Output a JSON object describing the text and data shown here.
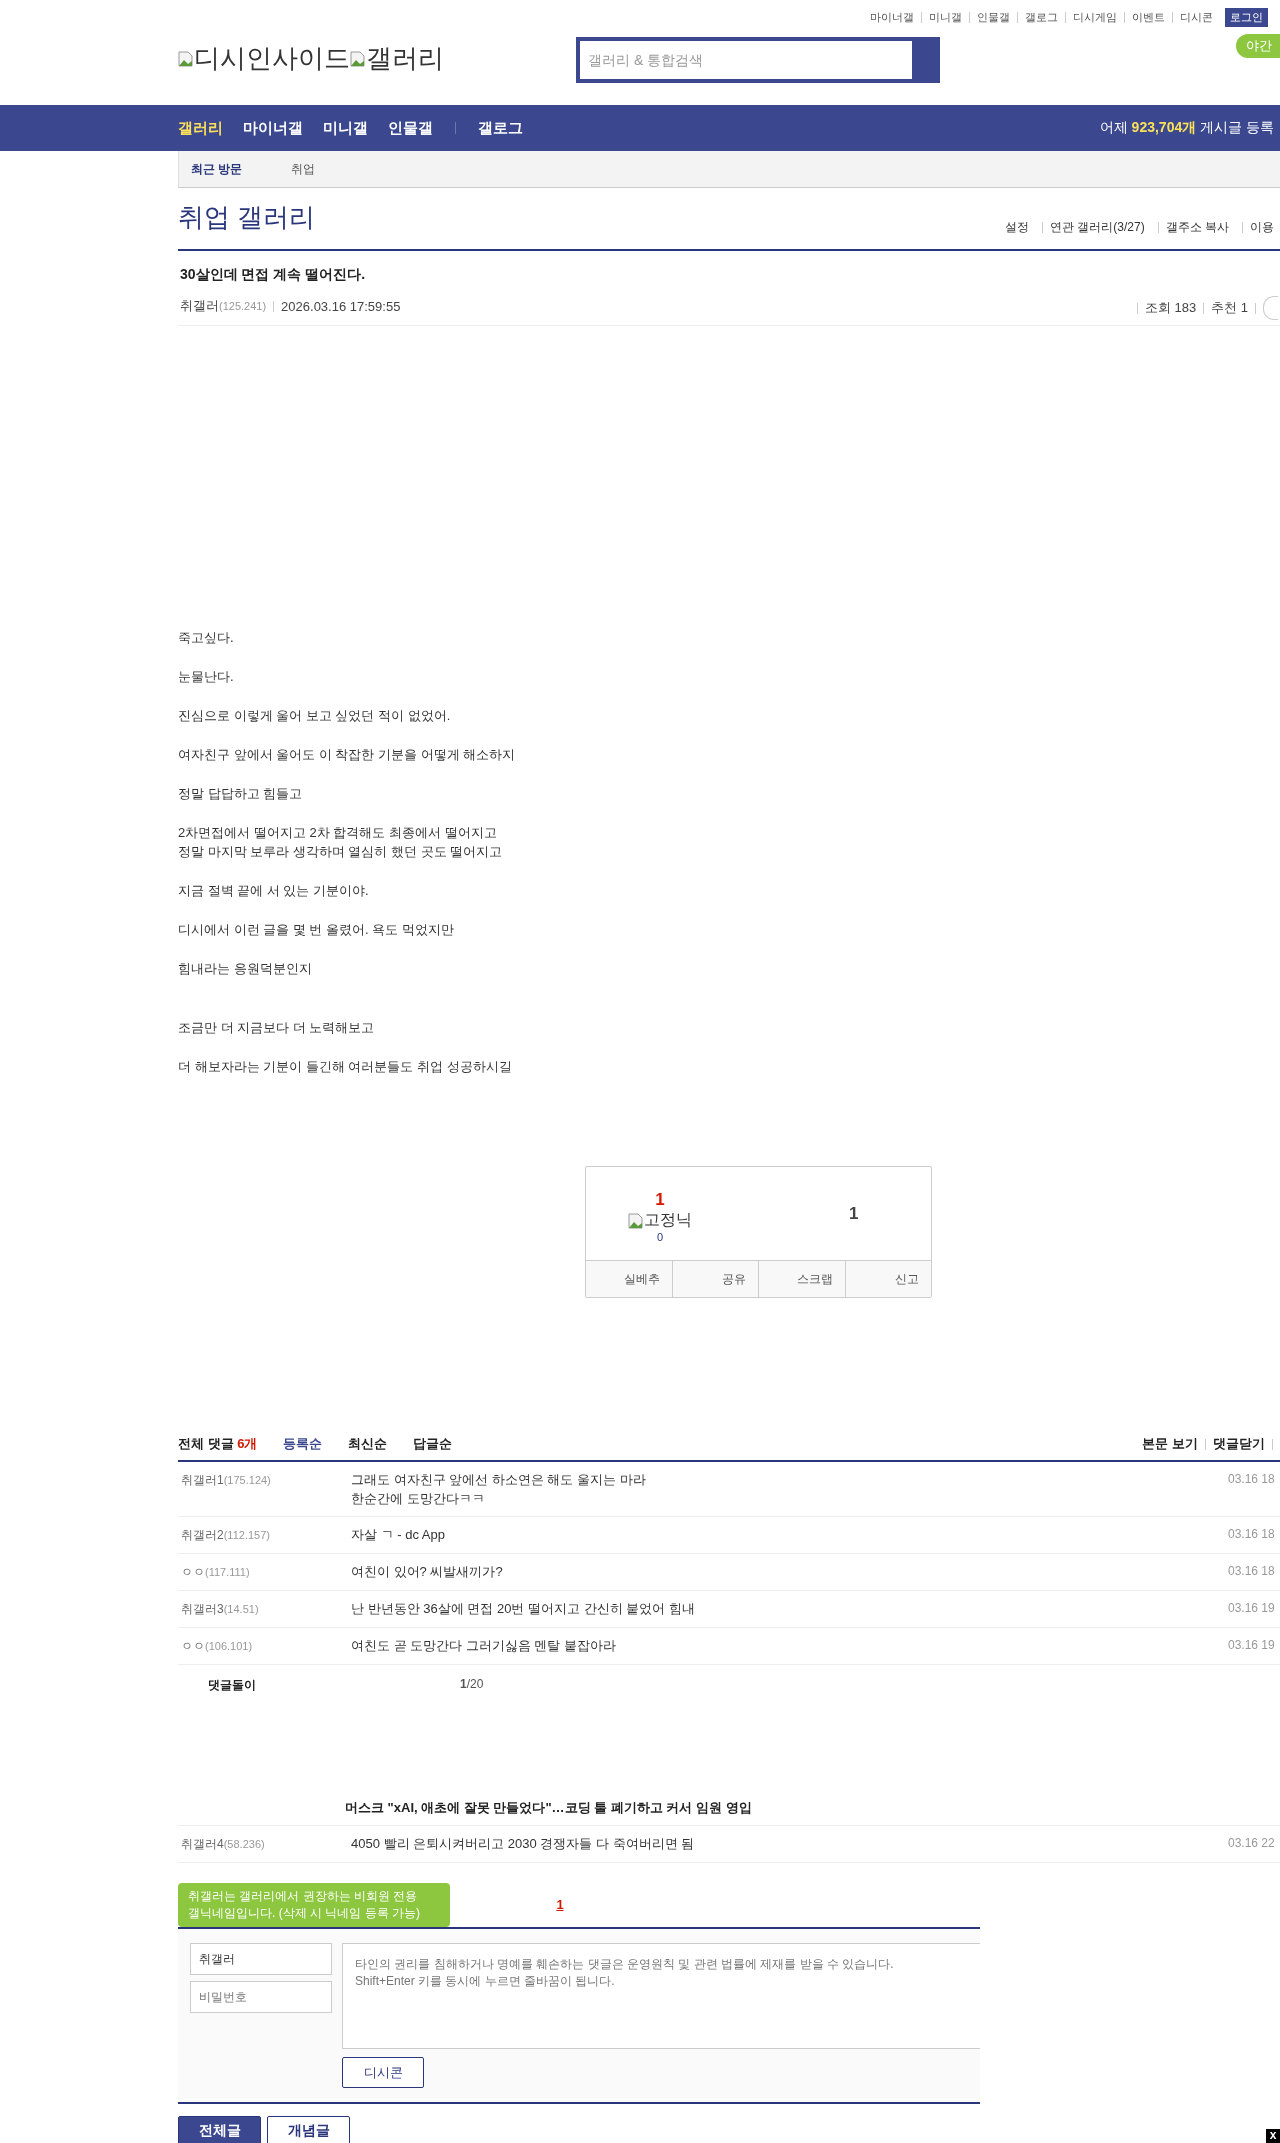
{
  "top_links": [
    "마이너갤",
    "미니갤",
    "인물갤",
    "갤로그",
    "디시게임",
    "이벤트",
    "디시콘"
  ],
  "login_button": "로그인",
  "night_mode": "야간",
  "logo": {
    "site": "디시인사이드",
    "section": "갤러리"
  },
  "search": {
    "placeholder": "갤러리 & 통합검색"
  },
  "nav": [
    {
      "label": "갤러리",
      "selected": true
    },
    {
      "label": "마이너갤",
      "selected": false
    },
    {
      "label": "미니갤",
      "selected": false
    },
    {
      "label": "인물갤",
      "selected": false
    },
    {
      "label": "갤로그",
      "selected": false
    }
  ],
  "daily_count": {
    "prefix": "어제",
    "count": "923,704개",
    "suffix": "게시글 등록"
  },
  "recent": {
    "label": "최근 방문",
    "items": [
      "취업"
    ]
  },
  "gallery_title": "취업 갤러리",
  "gallery_links": [
    "설정",
    "연관 갤러리(3/27)",
    "갤주소 복사",
    "이용"
  ],
  "post": {
    "title": "30살인데 면접 계속 떨어진다.",
    "author": "취갤러",
    "ip": "(125.241)",
    "date": "2026.03.16 17:59:55",
    "views": "조회 183",
    "recommends": "추천 1",
    "body": [
      [
        "죽고싶다."
      ],
      [
        "눈물난다."
      ],
      [
        "진심으로 이렇게 울어 보고 싶었던 적이 없었어."
      ],
      [
        "여자친구 앞에서 울어도 이 착잡한 기분을 어떻게 해소하지"
      ],
      [
        "정말 답답하고 힘들고"
      ],
      [
        "2차면접에서 떨어지고 2차 합격해도 최종에서 떨어지고",
        "정말 마지막 보루라 생각하며 열심히 했던 곳도 떨어지고"
      ],
      [
        "지금 절벽 끝에 서 있는 기분이야."
      ],
      [
        "디시에서 이런 글을 몇 번 올렸어. 욕도 먹었지만"
      ],
      [
        "힘내라는 응원덕분인지"
      ],
      [
        "조금만 더 지금보다 더 노력해보고"
      ],
      [
        "더 해보자라는 기분이 들긴해 여러분들도 취업 성공하시길"
      ]
    ]
  },
  "vote": {
    "up": "1",
    "fixed_nick": "고정닉",
    "fixed_count": "0",
    "down": "1",
    "actions": [
      "실베추",
      "공유",
      "스크랩",
      "신고"
    ]
  },
  "comments": {
    "label": "전체 댓글",
    "count": "6개",
    "sorts": [
      {
        "label": "등록순",
        "selected": true
      },
      {
        "label": "최신순",
        "selected": false
      },
      {
        "label": "답글순",
        "selected": false
      }
    ],
    "links": [
      "본문 보기",
      "댓글닫기"
    ],
    "rows": [
      {
        "kind": "comment",
        "nick": "취갤러1",
        "ip": "(175.124)",
        "lines": [
          "그래도 여자친구 앞에선 하소연은 해도 울지는 마라",
          "한순간에 도망간다ㅋㅋ"
        ],
        "date": "03.16 18"
      },
      {
        "kind": "comment",
        "nick": "취갤러2",
        "ip": "(112.157)",
        "lines": [
          "자살 ㄱ - dc App"
        ],
        "date": "03.16 18"
      },
      {
        "kind": "comment",
        "nick": "ㅇㅇ",
        "ip": "(117.111)",
        "lines": [
          "여친이 있어? 씨발새끼가?"
        ],
        "date": "03.16 18"
      },
      {
        "kind": "comment",
        "nick": "취갤러3",
        "ip": "(14.51)",
        "lines": [
          "난 반년동안 36살에 면접 20번 떨어지고 간신히 붙었어 힘내"
        ],
        "date": "03.16 19"
      },
      {
        "kind": "comment",
        "nick": "ㅇㅇ",
        "ip": "(106.101)",
        "lines": [
          "여친도 곧 도망간다 그러기싫음 멘탈 붙잡아라"
        ],
        "date": "03.16 19"
      },
      {
        "kind": "bot",
        "nick": "댓글돌이",
        "page": "1",
        "total": "/20"
      },
      {
        "kind": "news",
        "lines": [
          "머스크 \"xAI, 애초에 잘못 만들었다\"…코딩 툴 폐기하고 커서 임원 영입"
        ]
      },
      {
        "kind": "comment",
        "nick": "취갤러4",
        "ip": "(58.236)",
        "lines": [
          "4050 빨리 은퇴시켜버리고 2030 경쟁자들 다 죽여버리면 됨"
        ],
        "date": "03.16 22"
      }
    ],
    "page": "1"
  },
  "write": {
    "tooltip": "취갤러는 갤러리에서 권장하는 비회원 전용\n갤닉네임입니다. (삭제 시 닉네임 등록 가능)",
    "name": "취갤러",
    "password_placeholder": "비밀번호",
    "text_placeholder": "타인의 권리를 침해하거나 명예를 훼손하는 댓글은 운영원칙 및 관련 법률에 제재를 받을 수 있습니다.\nShift+Enter 키를 동시에 누르면 줄바꿈이 됩니다.",
    "dccon": "디시콘"
  },
  "list_tabs": [
    {
      "label": "전체글",
      "selected": true
    },
    {
      "label": "개념글",
      "selected": false
    }
  ],
  "close_mark": "x"
}
